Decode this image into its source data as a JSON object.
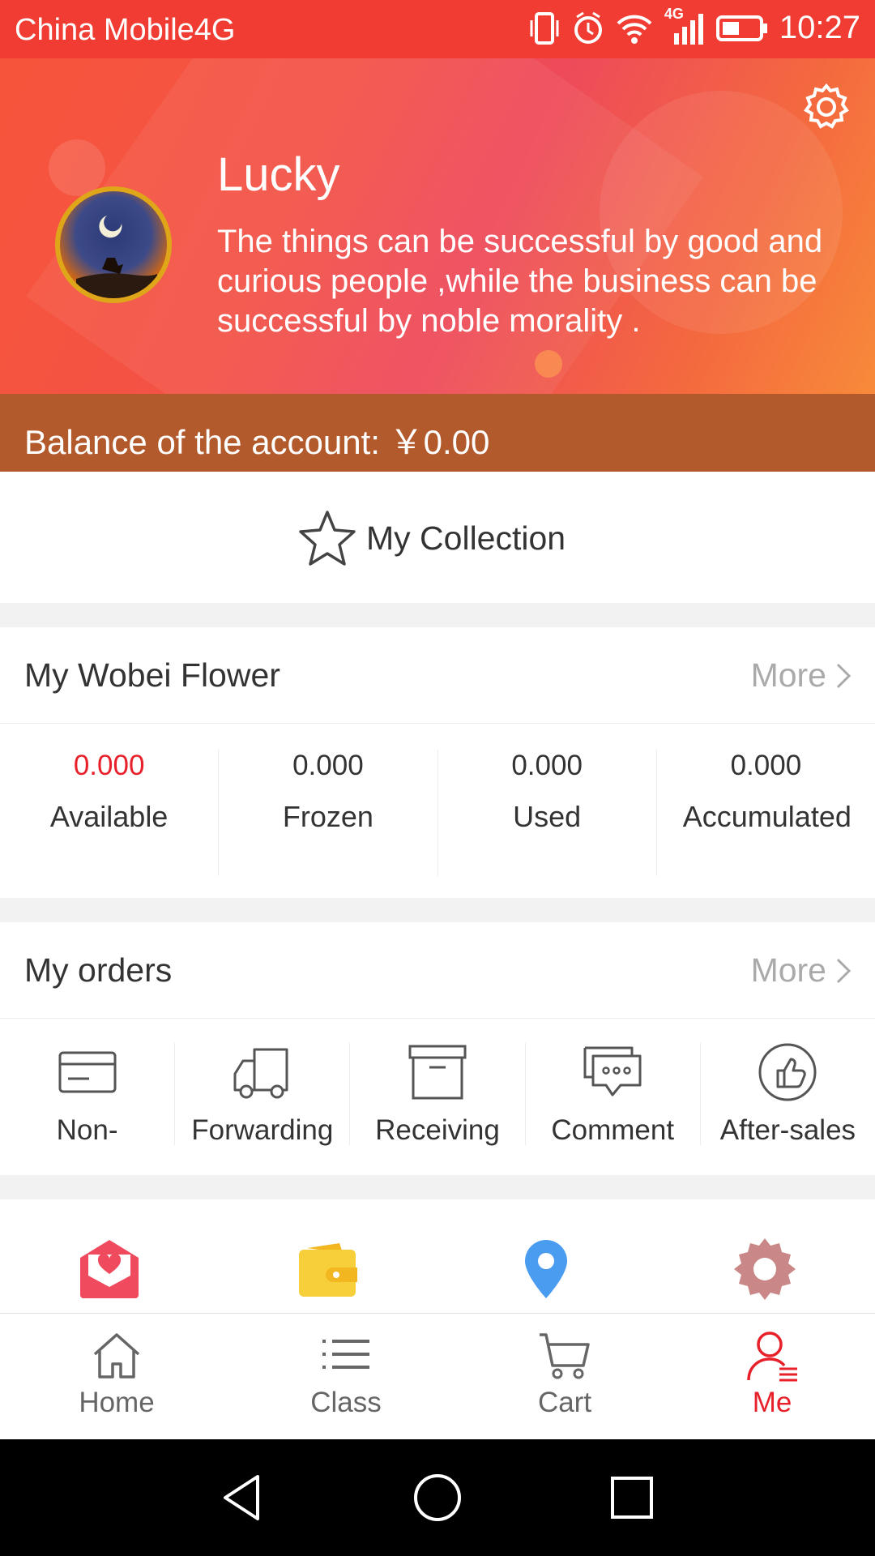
{
  "status_bar": {
    "carrier": "China Mobile4G",
    "network_label": "4G",
    "time": "10:27"
  },
  "profile": {
    "username": "Lucky",
    "motto": "The things can be successful by good and curious people ,while the business can be successful by noble morality ."
  },
  "balance": {
    "label": "Balance of the account:",
    "value": "￥0.00"
  },
  "collection": {
    "label": "My Collection"
  },
  "flower": {
    "title": "My Wobei Flower",
    "more": "More",
    "stats": [
      {
        "value": "0.000",
        "label": "Available"
      },
      {
        "value": "0.000",
        "label": "Frozen"
      },
      {
        "value": "0.000",
        "label": "Used"
      },
      {
        "value": "0.000",
        "label": "Accumulated"
      }
    ]
  },
  "orders": {
    "title": "My orders",
    "more": "More",
    "items": [
      {
        "label": "Non-",
        "icon": "card-icon"
      },
      {
        "label": "Forwarding",
        "icon": "truck-icon"
      },
      {
        "label": "Receiving",
        "icon": "box-icon"
      },
      {
        "label": "Comment",
        "icon": "chat-icon"
      },
      {
        "label": "After-sales",
        "icon": "thumbs-up-icon"
      }
    ]
  },
  "quick_icons": [
    "envelope-heart-icon",
    "wallet-icon",
    "location-pin-icon",
    "gear-icon"
  ],
  "tabs": [
    {
      "label": "Home",
      "icon": "home-icon"
    },
    {
      "label": "Class",
      "icon": "list-icon"
    },
    {
      "label": "Cart",
      "icon": "cart-icon"
    },
    {
      "label": "Me",
      "icon": "user-icon",
      "active": true
    }
  ],
  "colors": {
    "brand_red": "#e8202a",
    "header_red": "#f03c32",
    "balance_bar": "#b25a2c"
  }
}
